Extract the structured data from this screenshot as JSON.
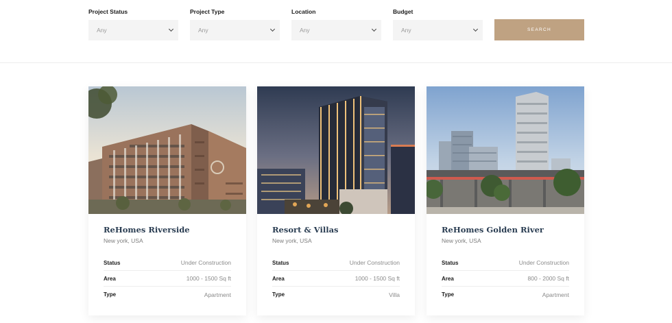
{
  "filters": [
    {
      "label": "Project Status",
      "value": "Any"
    },
    {
      "label": "Project Type",
      "value": "Any"
    },
    {
      "label": "Location",
      "value": "Any"
    },
    {
      "label": "Budget",
      "value": "Any"
    }
  ],
  "search": {
    "label": "SEARCH"
  },
  "colors": {
    "accent": "#bfa282",
    "title": "#2a3d52",
    "select_bg": "#f4f4f4"
  },
  "projects": [
    {
      "title": "ReHomes Riverside",
      "location": "New york, USA",
      "specs": [
        {
          "key": "Status",
          "value": "Under Construction"
        },
        {
          "key": "Area",
          "value": "1000 - 1500 Sq ft"
        },
        {
          "key": "Type",
          "value": "Apartment"
        }
      ]
    },
    {
      "title": "Resort & Villas",
      "location": "New york, USA",
      "specs": [
        {
          "key": "Status",
          "value": "Under Construction"
        },
        {
          "key": "Area",
          "value": "1000 - 1500 Sq ft"
        },
        {
          "key": "Type",
          "value": "Villa"
        }
      ]
    },
    {
      "title": "ReHomes Golden River",
      "location": "New york, USA",
      "specs": [
        {
          "key": "Status",
          "value": "Under Construction"
        },
        {
          "key": "Area",
          "value": "800 - 2000 Sq ft"
        },
        {
          "key": "Type",
          "value": "Apartment"
        }
      ]
    }
  ]
}
